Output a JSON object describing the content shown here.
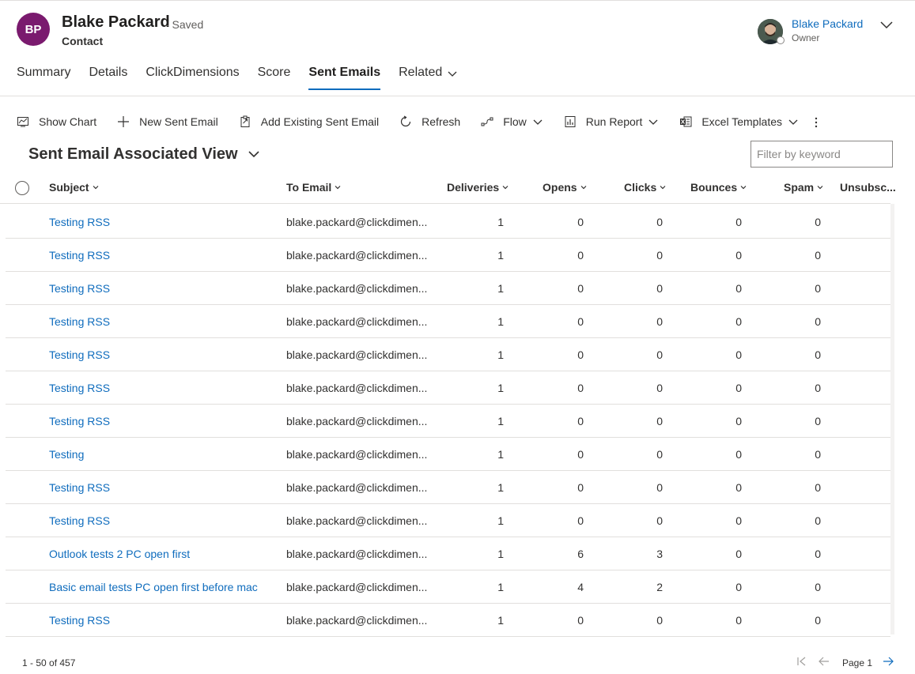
{
  "header": {
    "initials": "BP",
    "record_name": "Blake Packard",
    "status": "- Saved",
    "record_type": "Contact",
    "owner_name": "Blake Packard",
    "owner_role": "Owner"
  },
  "tabs": [
    {
      "label": "Summary"
    },
    {
      "label": "Details"
    },
    {
      "label": "ClickDimensions"
    },
    {
      "label": "Score"
    },
    {
      "label": "Sent Emails",
      "active": true
    },
    {
      "label": "Related"
    }
  ],
  "commands": {
    "show_chart": "Show Chart",
    "new_sent_email": "New Sent Email",
    "add_existing": "Add Existing Sent Email",
    "refresh": "Refresh",
    "flow": "Flow",
    "run_report": "Run Report",
    "excel_templates": "Excel Templates"
  },
  "view": {
    "title": "Sent Email Associated View",
    "filter_placeholder": "Filter by keyword"
  },
  "columns": {
    "subject": "Subject",
    "to_email": "To Email",
    "deliveries": "Deliveries",
    "opens": "Opens",
    "clicks": "Clicks",
    "bounces": "Bounces",
    "spam": "Spam",
    "unsubscribed": "Unsubsc..."
  },
  "rows": [
    {
      "subject": "Testing RSS",
      "to_email": "blake.packard@clickdimen...",
      "deliveries": "1",
      "opens": "0",
      "clicks": "0",
      "bounces": "0",
      "spam": "0"
    },
    {
      "subject": "Testing RSS",
      "to_email": "blake.packard@clickdimen...",
      "deliveries": "1",
      "opens": "0",
      "clicks": "0",
      "bounces": "0",
      "spam": "0"
    },
    {
      "subject": "Testing RSS",
      "to_email": "blake.packard@clickdimen...",
      "deliveries": "1",
      "opens": "0",
      "clicks": "0",
      "bounces": "0",
      "spam": "0"
    },
    {
      "subject": "Testing RSS",
      "to_email": "blake.packard@clickdimen...",
      "deliveries": "1",
      "opens": "0",
      "clicks": "0",
      "bounces": "0",
      "spam": "0"
    },
    {
      "subject": "Testing RSS",
      "to_email": "blake.packard@clickdimen...",
      "deliveries": "1",
      "opens": "0",
      "clicks": "0",
      "bounces": "0",
      "spam": "0"
    },
    {
      "subject": "Testing RSS",
      "to_email": "blake.packard@clickdimen...",
      "deliveries": "1",
      "opens": "0",
      "clicks": "0",
      "bounces": "0",
      "spam": "0"
    },
    {
      "subject": "Testing RSS",
      "to_email": "blake.packard@clickdimen...",
      "deliveries": "1",
      "opens": "0",
      "clicks": "0",
      "bounces": "0",
      "spam": "0"
    },
    {
      "subject": "Testing",
      "to_email": "blake.packard@clickdimen...",
      "deliveries": "1",
      "opens": "0",
      "clicks": "0",
      "bounces": "0",
      "spam": "0"
    },
    {
      "subject": "Testing RSS",
      "to_email": "blake.packard@clickdimen...",
      "deliveries": "1",
      "opens": "0",
      "clicks": "0",
      "bounces": "0",
      "spam": "0"
    },
    {
      "subject": "Testing RSS",
      "to_email": "blake.packard@clickdimen...",
      "deliveries": "1",
      "opens": "0",
      "clicks": "0",
      "bounces": "0",
      "spam": "0"
    },
    {
      "subject": "Outlook tests 2 PC open first",
      "to_email": "blake.packard@clickdimen...",
      "deliveries": "1",
      "opens": "6",
      "clicks": "3",
      "bounces": "0",
      "spam": "0"
    },
    {
      "subject": "Basic email tests PC open first before mac",
      "to_email": "blake.packard@clickdimen...",
      "deliveries": "1",
      "opens": "4",
      "clicks": "2",
      "bounces": "0",
      "spam": "0"
    },
    {
      "subject": "Testing RSS",
      "to_email": "blake.packard@clickdimen...",
      "deliveries": "1",
      "opens": "0",
      "clicks": "0",
      "bounces": "0",
      "spam": "0"
    }
  ],
  "footer": {
    "record_count": "1 - 50 of 457",
    "page_label": "Page 1"
  },
  "colors": {
    "accent": "#0f6cbd",
    "avatar": "#7a1a6e"
  }
}
